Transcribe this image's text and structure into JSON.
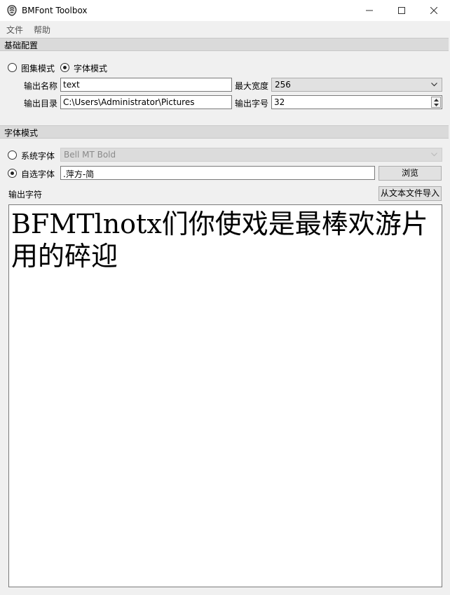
{
  "window": {
    "title": "BMFont Toolbox"
  },
  "menu": {
    "file": "文件",
    "help": "帮助"
  },
  "basic": {
    "header": "基础配置",
    "atlas_mode": "图集模式",
    "font_mode": "字体模式",
    "output_name_label": "输出名称",
    "output_name_value": "text",
    "max_width_label": "最大宽度",
    "max_width_value": "256",
    "output_dir_label": "输出目录",
    "output_dir_value": "C:\\Users\\Administrator\\Pictures",
    "output_size_label": "输出字号",
    "output_size_value": "32"
  },
  "font": {
    "header": "字体模式",
    "system_font_label": "系统字体",
    "system_font_value": "Bell MT Bold",
    "custom_font_label": "自选字体",
    "custom_font_value": ".萍方-简",
    "browse_button": "浏览",
    "output_chars_label": "输出字符",
    "import_button": "从文本文件导入",
    "output_chars_value": "BFMTlnotx们你使戏是最棒欢游片用的碎迎"
  },
  "icons": {
    "app": "bmfont-app-icon",
    "minimize": "minimize-icon",
    "maximize": "maximize-icon",
    "close": "close-icon",
    "dropdown": "chevron-down-icon",
    "spin_up": "spin-up-icon",
    "spin_down": "spin-down-icon"
  }
}
